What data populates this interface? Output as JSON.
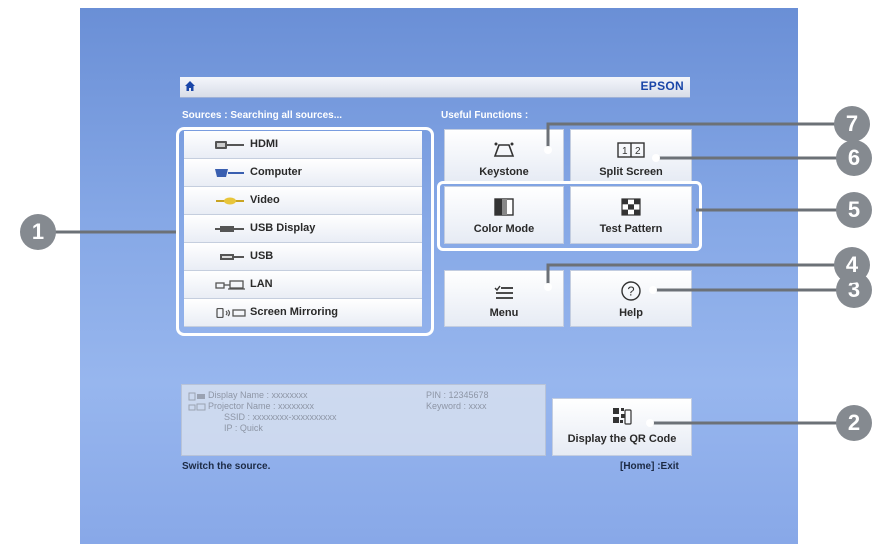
{
  "header": {
    "brand": "EPSON"
  },
  "sources": {
    "title": "Sources : Searching all sources...",
    "items": [
      {
        "label": "HDMI",
        "icon": "hdmi-icon"
      },
      {
        "label": "Computer",
        "icon": "computer-port-icon"
      },
      {
        "label": "Video",
        "icon": "video-port-icon"
      },
      {
        "label": "USB Display",
        "icon": "usb-display-icon"
      },
      {
        "label": "USB",
        "icon": "usb-icon"
      },
      {
        "label": "LAN",
        "icon": "lan-icon"
      },
      {
        "label": "Screen Mirroring",
        "icon": "screen-mirroring-icon"
      }
    ]
  },
  "functions": {
    "title": "Useful Functions :",
    "keystone": "Keystone",
    "split_screen": "Split Screen",
    "color_mode": "Color Mode",
    "test_pattern": "Test Pattern",
    "menu": "Menu",
    "help": "Help"
  },
  "network_info": {
    "display_name": "Display Name : xxxxxxxx",
    "projector_name": "Projector Name : xxxxxxxx",
    "ssid": "SSID : xxxxxxxx-xxxxxxxxxx",
    "ip": "IP : Quick",
    "pin": "PIN : 12345678",
    "keyword": "Keyword : xxxx"
  },
  "qr": {
    "label": "Display the QR Code"
  },
  "footer": {
    "hint": "Switch the source.",
    "exit": "[Home] :Exit"
  },
  "callouts": [
    "1",
    "2",
    "3",
    "4",
    "5",
    "6",
    "7"
  ],
  "colors": {
    "accent": "#1a46a8",
    "background": "#86a8e6",
    "callout": "#858a90"
  }
}
